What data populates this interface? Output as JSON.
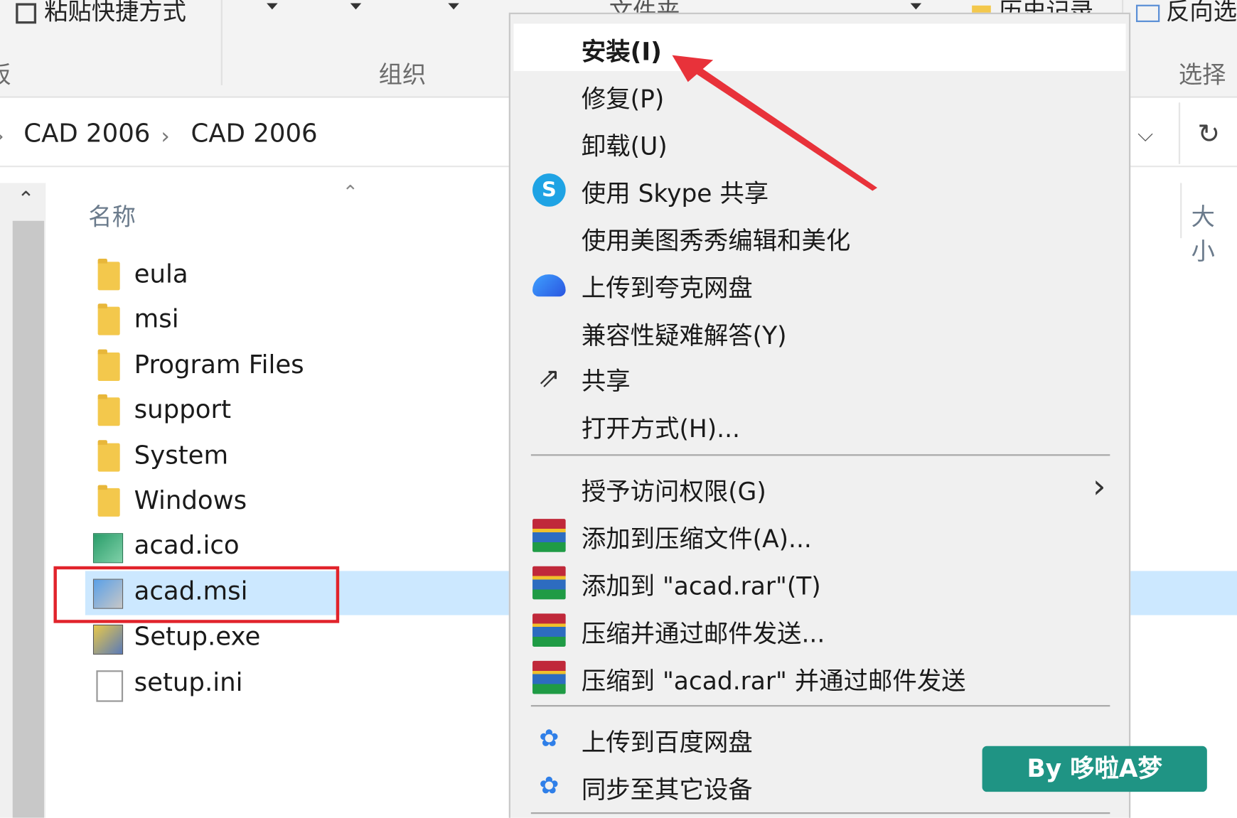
{
  "ribbon": {
    "paste_shortcut": "粘贴快捷方式",
    "group_left": "板",
    "group_organize": "组织",
    "group_select": "选择",
    "invert": "反向选择",
    "history": "历史记录",
    "new_file": "文件夹"
  },
  "breadcrumb": [
    "CAD 2006",
    "CAD 2006"
  ],
  "columns": {
    "name": "名称",
    "size": "大小"
  },
  "files": [
    {
      "name": "eula",
      "icon": "folder-icon"
    },
    {
      "name": "msi",
      "icon": "folder-icon"
    },
    {
      "name": "Program Files",
      "icon": "folder-icon"
    },
    {
      "name": "support",
      "icon": "folder-icon"
    },
    {
      "name": "System",
      "icon": "folder-icon"
    },
    {
      "name": "Windows",
      "icon": "folder-icon"
    },
    {
      "name": "acad.ico",
      "icon": "ico-file-icon"
    },
    {
      "name": "acad.msi",
      "icon": "installer-icon",
      "selected": true
    },
    {
      "name": "Setup.exe",
      "icon": "setup-exe-icon"
    },
    {
      "name": "setup.ini",
      "icon": "ini-file-icon"
    }
  ],
  "context_menu": {
    "install": "安装(I)",
    "repair": "修复(P)",
    "uninstall": "卸载(U)",
    "skype_share": "使用 Skype 共享",
    "meitu": "使用美图秀秀编辑和美化",
    "quark": "上传到夸克网盘",
    "compat": "兼容性疑难解答(Y)",
    "share": "共享",
    "open_with": "打开方式(H)...",
    "grant_access": "授予访问权限(G)",
    "add_archive": "添加到压缩文件(A)...",
    "add_rar": "添加到 \"acad.rar\"(T)",
    "compress_email": "压缩并通过邮件发送...",
    "compress_rar_email": "压缩到 \"acad.rar\" 并通过邮件发送",
    "baidu_upload": "上传到百度网盘",
    "sync_devices": "同步至其它设备"
  },
  "watermark": "By 哆啦A梦",
  "colors": {
    "selection": "#cce8ff",
    "annotation_red": "#e1232b",
    "watermark_bg": "#1f9484"
  }
}
